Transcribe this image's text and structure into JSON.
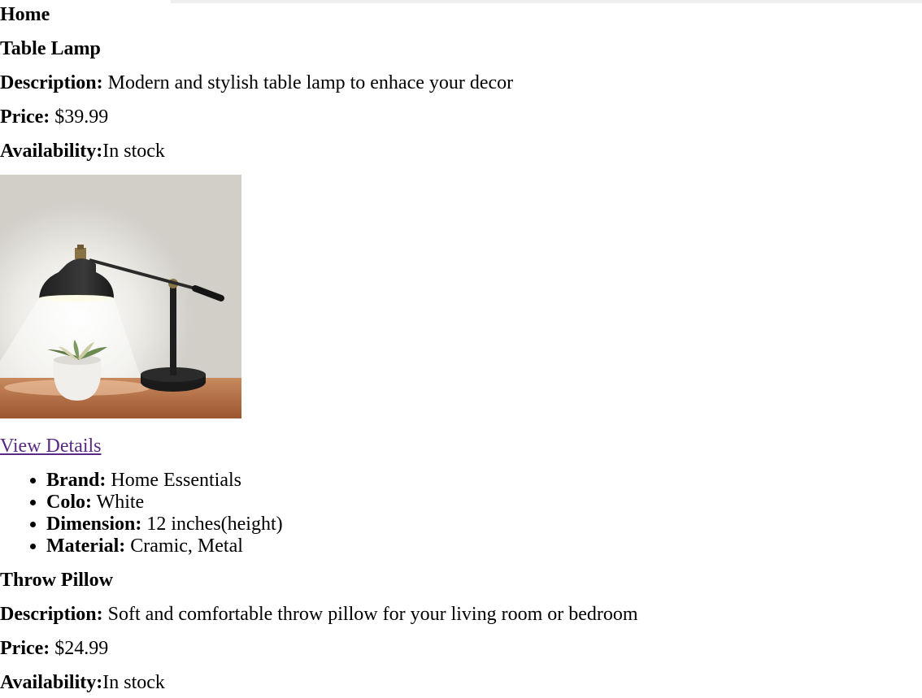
{
  "page": {
    "heading": "Home"
  },
  "products": [
    {
      "name": "Table Lamp",
      "description_label": "Description:",
      "description": " Modern and stylish table lamp to enhace your decor",
      "price_label": "Price:",
      "price": " $39.99",
      "availability_label": "Availability:",
      "availability": "In stock",
      "image_icon": "table-lamp-photo",
      "details_link": "View Details",
      "specs": [
        {
          "label": "Brand:",
          "value": " Home Essentials"
        },
        {
          "label": "Colo:",
          "value": " White"
        },
        {
          "label": "Dimension:",
          "value": " 12 inches(height)"
        },
        {
          "label": "Material:",
          "value": " Cramic, Metal"
        }
      ]
    },
    {
      "name": "Throw Pillow",
      "description_label": "Description:",
      "description": " Soft and comfortable throw pillow for your living room or bedroom",
      "price_label": "Price:",
      "price": " $24.99",
      "availability_label": "Availability:",
      "availability": "In stock"
    }
  ],
  "colors": {
    "link_visited": "#5a2a82",
    "text": "#000000",
    "background": "#ffffff"
  }
}
